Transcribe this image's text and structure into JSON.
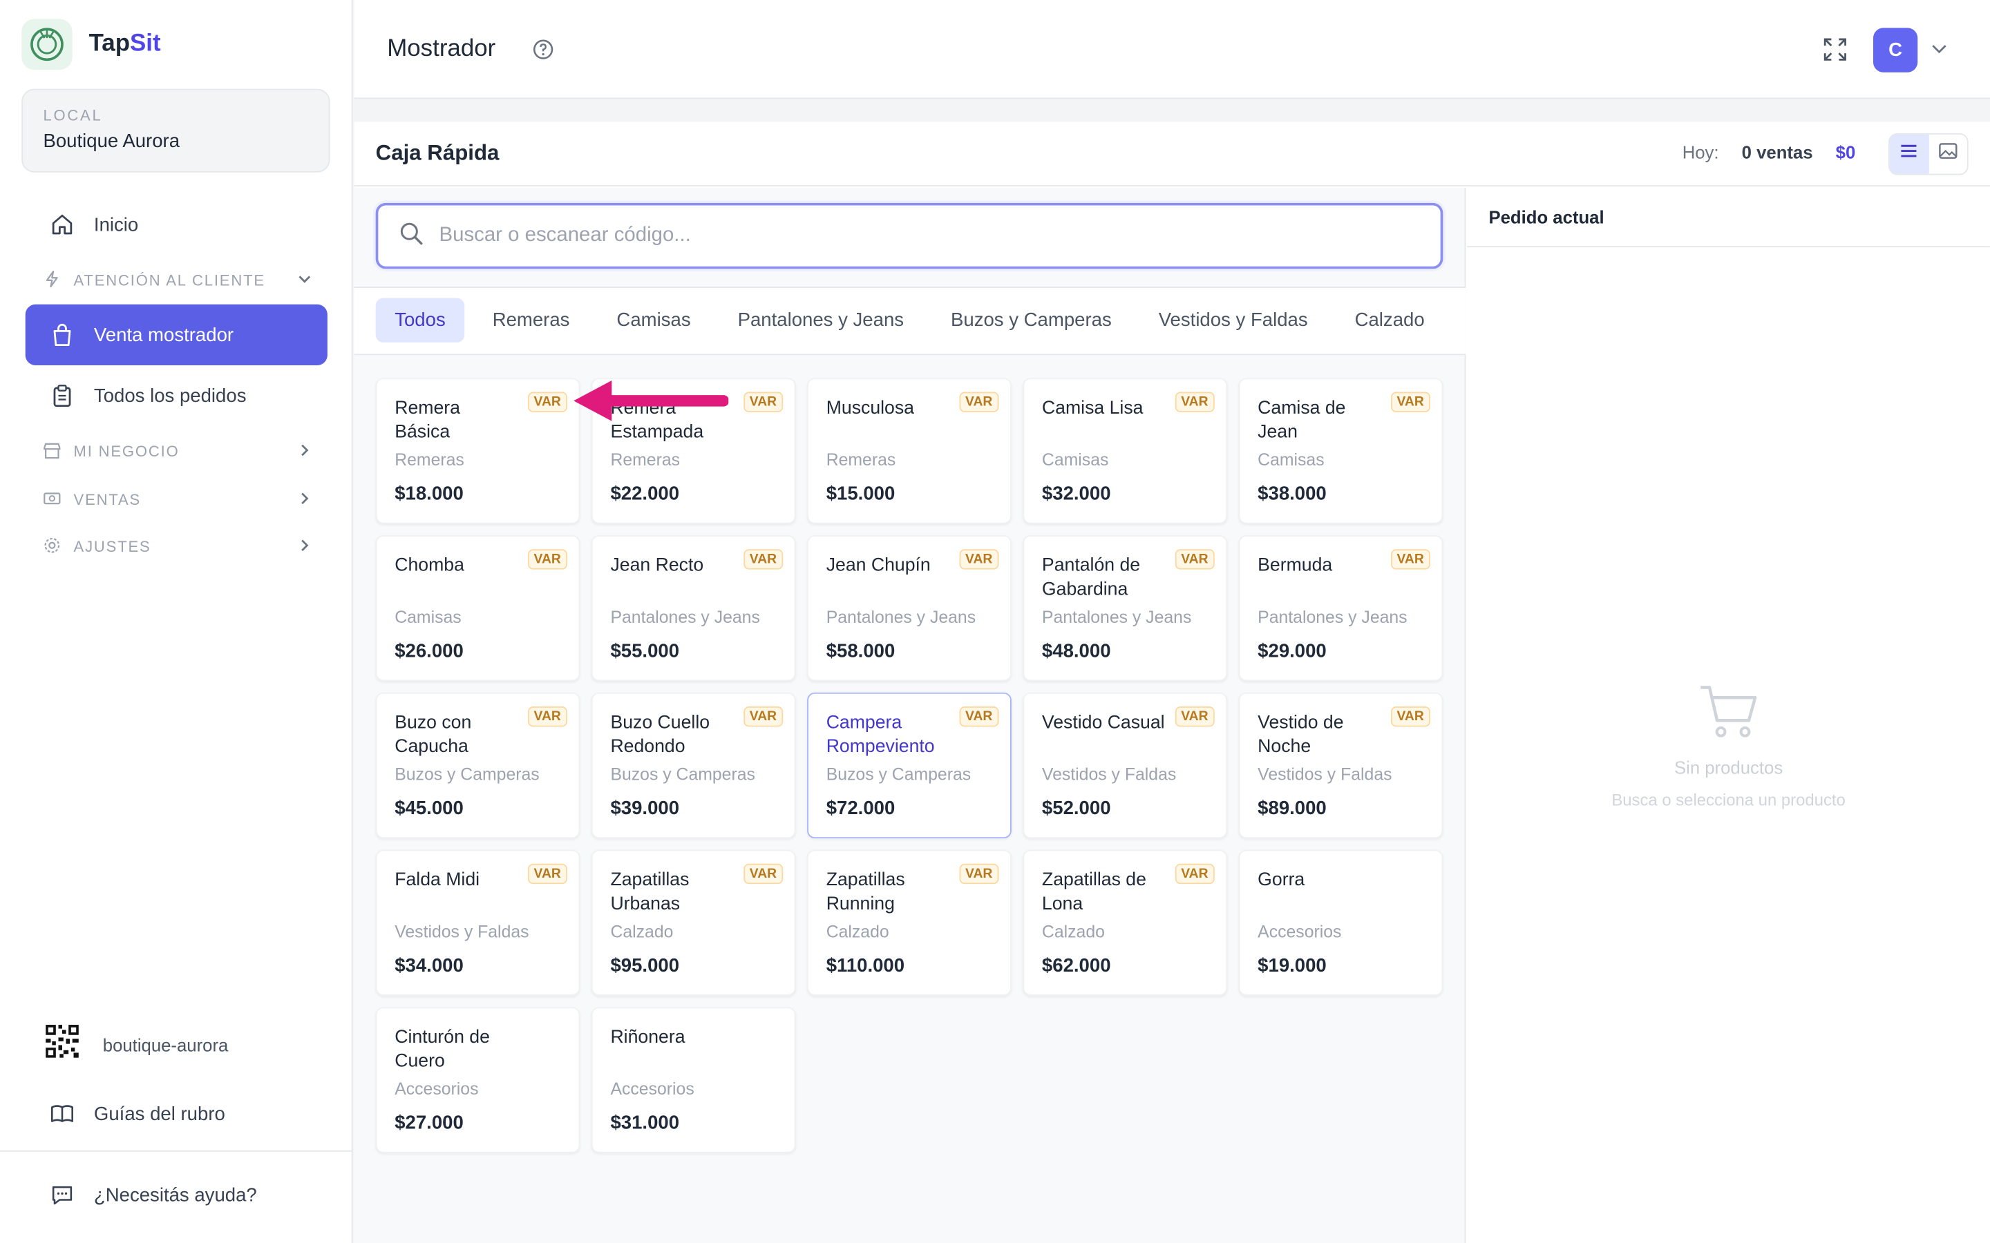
{
  "brand": {
    "name_a": "Tap",
    "name_b": "Sit"
  },
  "local": {
    "label": "LOCAL",
    "name": "Boutique Aurora"
  },
  "sidebar": {
    "inicio": "Inicio",
    "section_atencion": "ATENCIÓN AL CLIENTE",
    "venta_mostrador": "Venta mostrador",
    "todos_pedidos": "Todos los pedidos",
    "section_negocio": "MI NEGOCIO",
    "section_ventas": "VENTAS",
    "section_ajustes": "AJUSTES",
    "qr_label": "boutique-aurora",
    "guias": "Guías del rubro",
    "ayuda": "¿Necesitás ayuda?"
  },
  "header": {
    "title": "Mostrador",
    "avatar_initial": "C"
  },
  "panel": {
    "title": "Caja Rápida",
    "today_label": "Hoy:",
    "today_sales": "0 ventas",
    "today_total": "$0"
  },
  "search": {
    "placeholder": "Buscar o escanear código..."
  },
  "categories": [
    "Todos",
    "Remeras",
    "Camisas",
    "Pantalones y Jeans",
    "Buzos y Camperas",
    "Vestidos y Faldas",
    "Calzado",
    "Accesorios"
  ],
  "products": [
    {
      "name": "Remera Básica",
      "category": "Remeras",
      "price": "$18.000",
      "var": "VAR"
    },
    {
      "name": "Remera Estampada",
      "category": "Remeras",
      "price": "$22.000",
      "var": "VAR"
    },
    {
      "name": "Musculosa",
      "category": "Remeras",
      "price": "$15.000",
      "var": "VAR"
    },
    {
      "name": "Camisa Lisa",
      "category": "Camisas",
      "price": "$32.000",
      "var": "VAR"
    },
    {
      "name": "Camisa de Jean",
      "category": "Camisas",
      "price": "$38.000",
      "var": "VAR"
    },
    {
      "name": "Chomba",
      "category": "Camisas",
      "price": "$26.000",
      "var": "VAR"
    },
    {
      "name": "Jean Recto",
      "category": "Pantalones y Jeans",
      "price": "$55.000",
      "var": "VAR"
    },
    {
      "name": "Jean Chupín",
      "category": "Pantalones y Jeans",
      "price": "$58.000",
      "var": "VAR"
    },
    {
      "name": "Pantalón de Gabardina",
      "category": "Pantalones y Jeans",
      "price": "$48.000",
      "var": "VAR"
    },
    {
      "name": "Bermuda",
      "category": "Pantalones y Jeans",
      "price": "$29.000",
      "var": "VAR"
    },
    {
      "name": "Buzo con Capucha",
      "category": "Buzos y Camperas",
      "price": "$45.000",
      "var": "VAR"
    },
    {
      "name": "Buzo Cuello Redondo",
      "category": "Buzos y Camperas",
      "price": "$39.000",
      "var": "VAR"
    },
    {
      "name": "Campera Rompeviento",
      "category": "Buzos y Camperas",
      "price": "$72.000",
      "var": "VAR",
      "selected": true
    },
    {
      "name": "Vestido Casual",
      "category": "Vestidos y Faldas",
      "price": "$52.000",
      "var": "VAR"
    },
    {
      "name": "Vestido de Noche",
      "category": "Vestidos y Faldas",
      "price": "$89.000",
      "var": "VAR"
    },
    {
      "name": "Falda Midi",
      "category": "Vestidos y Faldas",
      "price": "$34.000",
      "var": "VAR"
    },
    {
      "name": "Zapatillas Urbanas",
      "category": "Calzado",
      "price": "$95.000",
      "var": "VAR"
    },
    {
      "name": "Zapatillas Running",
      "category": "Calzado",
      "price": "$110.000",
      "var": "VAR"
    },
    {
      "name": "Zapatillas de Lona",
      "category": "Calzado",
      "price": "$62.000",
      "var": "VAR"
    },
    {
      "name": "Gorra",
      "category": "Accesorios",
      "price": "$19.000",
      "var": ""
    },
    {
      "name": "Cinturón de Cuero",
      "category": "Accesorios",
      "price": "$27.000",
      "var": ""
    },
    {
      "name": "Riñonera",
      "category": "Accesorios",
      "price": "$31.000",
      "var": ""
    }
  ],
  "order": {
    "title": "Pedido actual",
    "empty_title": "Sin productos",
    "empty_sub": "Busca o selecciona un producto"
  },
  "colors": {
    "accent": "#5b5fe6",
    "var_badge": "#b7791f",
    "annotation_arrow": "#e0197d"
  }
}
